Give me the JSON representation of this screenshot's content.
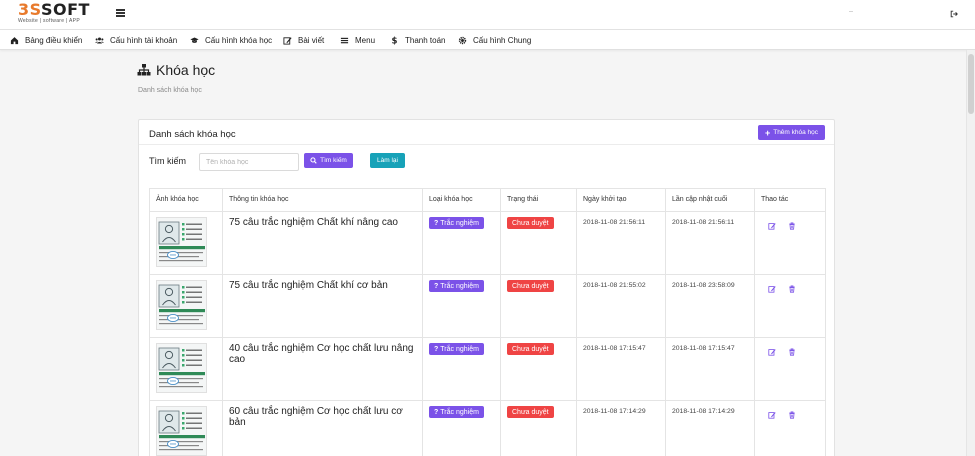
{
  "brand": {
    "logo_accent": "3S",
    "logo_dark": "SOFT",
    "tagline": "Website | software | APP",
    "accent_color": "#e87a2c"
  },
  "header": {
    "user_name": "—",
    "logout_icon": "sign-out-icon"
  },
  "nav": [
    {
      "label": "Bảng điều khiển",
      "icon": "dashboard-icon"
    },
    {
      "label": "Cấu hình tài khoản",
      "icon": "users-icon"
    },
    {
      "label": "Cấu hình khóa học",
      "icon": "graduation-cap-icon"
    },
    {
      "label": "Bài viết",
      "icon": "edit-icon"
    },
    {
      "label": "Menu",
      "icon": "bars-icon"
    },
    {
      "label": "Thanh toán",
      "icon": "dollar-icon"
    },
    {
      "label": "Cấu hình Chung",
      "icon": "cog-icon"
    }
  ],
  "page": {
    "title": "Khóa học",
    "subtitle": "Danh sách khóa học",
    "icon": "sitemap-icon"
  },
  "card": {
    "title": "Danh sách khóa học",
    "add_button": "Thêm khóa học",
    "search_label": "Tìm kiếm",
    "search_placeholder": "Tên khóa học",
    "search_value": "",
    "search_button": "Tìm kiếm",
    "reset_button": "Làm lại"
  },
  "table": {
    "headers": [
      "Ảnh khóa học",
      "Thông tin khóa học",
      "Loại khóa học",
      "Trạng thái",
      "Ngày khởi tạo",
      "Lần cập nhật cuối",
      "Thao tác"
    ],
    "rows": [
      {
        "name": "75 câu trắc nghiệm Chất khí nâng cao",
        "type": "Trắc nghiệm",
        "status": "Chưa duyệt",
        "created": "2018-11-08 21:56:11",
        "updated": "2018-11-08 21:56:11"
      },
      {
        "name": "75 câu trắc nghiệm Chất khí cơ bản",
        "type": "Trắc nghiệm",
        "status": "Chưa duyệt",
        "created": "2018-11-08 21:55:02",
        "updated": "2018-11-08 23:58:09"
      },
      {
        "name": "40 câu trắc nghiệm Cơ học chất lưu nâng cao",
        "type": "Trắc nghiệm",
        "status": "Chưa duyệt",
        "created": "2018-11-08 17:15:47",
        "updated": "2018-11-08 17:15:47"
      },
      {
        "name": "60 câu trắc nghiệm Cơ học chất lưu cơ bản",
        "type": "Trắc nghiệm",
        "status": "Chưa duyệt",
        "created": "2018-11-08 17:14:29",
        "updated": "2018-11-08 17:14:29"
      }
    ]
  },
  "watermark": {
    "accent": "3S",
    "dark": "SOFT",
    "tagline": "Website | software | APP"
  },
  "colors": {
    "primary": "#7b52e8",
    "info": "#17a2b8",
    "danger": "#ef4444"
  }
}
